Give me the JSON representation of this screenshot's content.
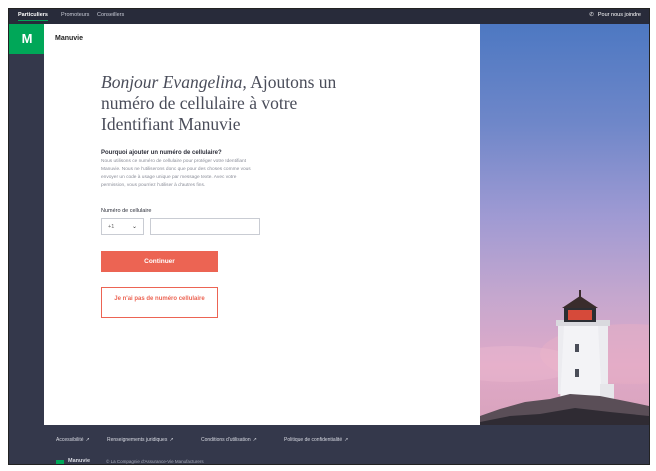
{
  "nav": {
    "tabs": [
      {
        "label": "Particuliers",
        "active": true
      },
      {
        "label": "Promoteurs",
        "active": false
      },
      {
        "label": "Conseillers",
        "active": false
      }
    ],
    "contact_label": "Pour nous joindre",
    "contact_icon": "phone-icon"
  },
  "brand": {
    "logo_text": "M",
    "app_name": "Manuvie"
  },
  "heading": {
    "greeting_name": "Bonjour Evangelina,",
    "text": "Ajoutons un numéro de cellulaire à votre Identifiant Manuvie"
  },
  "info": {
    "title": "Pourquoi ajouter un numéro de cellulaire?",
    "body": "Nous utilisons ce numéro de cellulaire pour protéger votre Identifiant Manuvie. Nous ne l'utiliserons donc que pour des choses comme vous envoyer un code à usage unique par message texte. Avec votre permission, vous pourriez l'utiliser à d'autres fins."
  },
  "form": {
    "phone_label": "Numéro de cellulaire",
    "country_code": "+1",
    "phone_value": "",
    "phone_placeholder": ""
  },
  "buttons": {
    "continue": "Continuer",
    "no_number": "Je n'ai pas de numéro cellulaire"
  },
  "footer": {
    "links": [
      {
        "label": "Accessibilité"
      },
      {
        "label": "Renseignements juridiques"
      },
      {
        "label": "Conditions d'utilisation"
      },
      {
        "label": "Politique de confidentialité"
      }
    ],
    "brand": "Manuvie",
    "copyright": "© La Compagnie d'Assurance-Vie Manufacturers"
  },
  "colors": {
    "accent": "#00a758",
    "button": "#ec6453",
    "nav_bg": "#282b3a",
    "footer_bg": "#34384b"
  }
}
